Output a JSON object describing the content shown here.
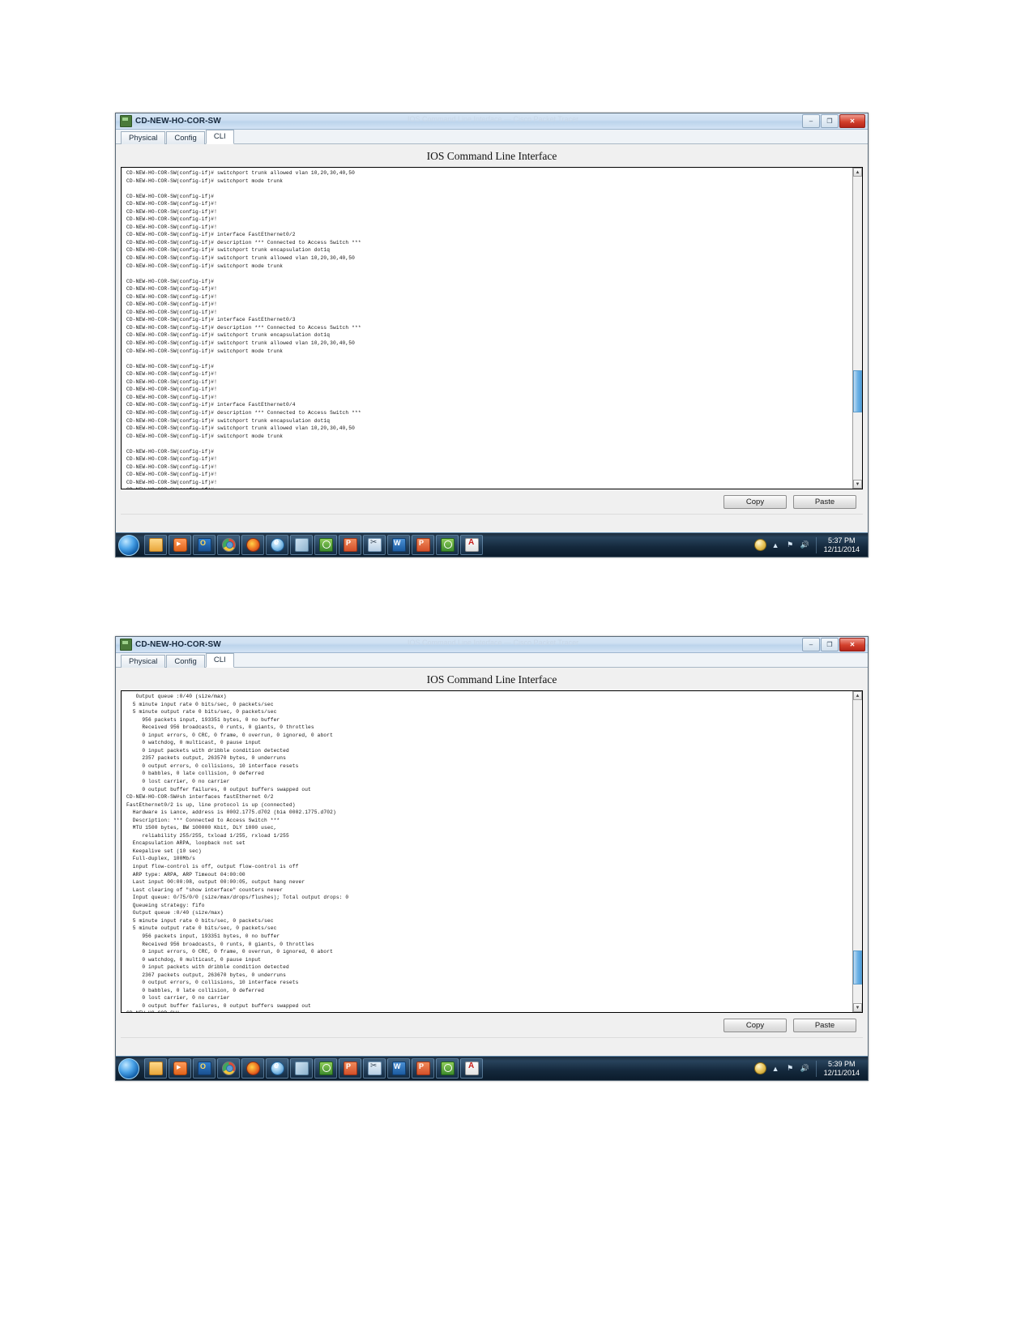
{
  "windows": [
    {
      "title": "CD-NEW-HO-COR-SW",
      "title_ghost": "IOS Command Line Interface — Cisco Packet Tracer",
      "icon": "packet-tracer-device-icon",
      "window_buttons": {
        "minimize": "–",
        "maximize": "❐",
        "close": "✕"
      },
      "tabs": [
        {
          "label": "Physical",
          "active": false
        },
        {
          "label": "Config",
          "active": false
        },
        {
          "label": "CLI",
          "active": true
        }
      ],
      "heading": "IOS Command Line Interface",
      "terminal_text": "CD-NEW-HO-COR-SW(config-if)# switchport trunk allowed vlan 10,20,30,40,50\nCD-NEW-HO-COR-SW(config-if)# switchport mode trunk\n\nCD-NEW-HO-COR-SW(config-if)#\nCD-NEW-HO-COR-SW(config-if)#!\nCD-NEW-HO-COR-SW(config-if)#!\nCD-NEW-HO-COR-SW(config-if)#!\nCD-NEW-HO-COR-SW(config-if)#!\nCD-NEW-HO-COR-SW(config-if)# interface FastEthernet0/2\nCD-NEW-HO-COR-SW(config-if)# description *** Connected to Access Switch ***\nCD-NEW-HO-COR-SW(config-if)# switchport trunk encapsulation dot1q\nCD-NEW-HO-COR-SW(config-if)# switchport trunk allowed vlan 10,20,30,40,50\nCD-NEW-HO-COR-SW(config-if)# switchport mode trunk\n\nCD-NEW-HO-COR-SW(config-if)#\nCD-NEW-HO-COR-SW(config-if)#!\nCD-NEW-HO-COR-SW(config-if)#!\nCD-NEW-HO-COR-SW(config-if)#!\nCD-NEW-HO-COR-SW(config-if)#!\nCD-NEW-HO-COR-SW(config-if)# interface FastEthernet0/3\nCD-NEW-HO-COR-SW(config-if)# description *** Connected to Access Switch ***\nCD-NEW-HO-COR-SW(config-if)# switchport trunk encapsulation dot1q\nCD-NEW-HO-COR-SW(config-if)# switchport trunk allowed vlan 10,20,30,40,50\nCD-NEW-HO-COR-SW(config-if)# switchport mode trunk\n\nCD-NEW-HO-COR-SW(config-if)#\nCD-NEW-HO-COR-SW(config-if)#!\nCD-NEW-HO-COR-SW(config-if)#!\nCD-NEW-HO-COR-SW(config-if)#!\nCD-NEW-HO-COR-SW(config-if)#!\nCD-NEW-HO-COR-SW(config-if)# interface FastEthernet0/4\nCD-NEW-HO-COR-SW(config-if)# description *** Connected to Access Switch ***\nCD-NEW-HO-COR-SW(config-if)# switchport trunk encapsulation dot1q\nCD-NEW-HO-COR-SW(config-if)# switchport trunk allowed vlan 10,20,30,40,50\nCD-NEW-HO-COR-SW(config-if)# switchport mode trunk\n\nCD-NEW-HO-COR-SW(config-if)#\nCD-NEW-HO-COR-SW(config-if)#!\nCD-NEW-HO-COR-SW(config-if)#!\nCD-NEW-HO-COR-SW(config-if)#!\nCD-NEW-HO-COR-SW(config-if)#!\nCD-NEW-HO-COR-SW(config-if)#",
      "buttons": {
        "copy": "Copy",
        "paste": "Paste"
      },
      "scrollbar": {
        "up_arrow": "▲",
        "down_arrow": "▼"
      },
      "taskbar": {
        "clock_time": "5:37 PM",
        "clock_date": "12/11/2014",
        "start_label": "start-orb",
        "items": [
          "windows-explorer-icon",
          "media-player-icon",
          "outlook-icon",
          "chrome-icon",
          "firefox-icon",
          "internet-explorer-icon",
          "notepad-icon",
          "packet-tracer-icon",
          "app-red-icon",
          "snipping-tool-icon",
          "word-icon",
          "app-orange-icon",
          "app-green-icon",
          "adobe-reader-icon"
        ],
        "tray": [
          "action-center-icon",
          "show-hidden-icon",
          "network-icon",
          "volume-icon"
        ]
      }
    },
    {
      "title": "CD-NEW-HO-COR-SW",
      "title_ghost": "IOS Command Line Interface — Cisco Packet Tracer",
      "icon": "packet-tracer-device-icon",
      "window_buttons": {
        "minimize": "–",
        "maximize": "❐",
        "close": "✕"
      },
      "tabs": [
        {
          "label": "Physical",
          "active": false
        },
        {
          "label": "Config",
          "active": false
        },
        {
          "label": "CLI",
          "active": true
        }
      ],
      "heading": "IOS Command Line Interface",
      "terminal_text": "   Output queue :0/40 (size/max)\n  5 minute input rate 0 bits/sec, 0 packets/sec\n  5 minute output rate 0 bits/sec, 0 packets/sec\n     956 packets input, 193351 bytes, 0 no buffer\n     Received 956 broadcasts, 0 runts, 0 giants, 0 throttles\n     0 input errors, 0 CRC, 0 frame, 0 overrun, 0 ignored, 0 abort\n     0 watchdog, 0 multicast, 0 pause input\n     0 input packets with dribble condition detected\n     2357 packets output, 263570 bytes, 0 underruns\n     0 output errors, 0 collisions, 10 interface resets\n     0 babbles, 0 late collision, 0 deferred\n     0 lost carrier, 0 no carrier\n     0 output buffer failures, 0 output buffers swapped out\nCD-NEW-HO-COR-SW#sh interfaces fastEthernet 0/2\nFastEthernet0/2 is up, line protocol is up (connected)\n  Hardware is Lance, address is 0002.1775.d702 (bia 0002.1775.d702)\n  Description: *** Connected to Access Switch ***\n  MTU 1500 bytes, BW 100000 Kbit, DLY 1000 usec,\n     reliability 255/255, txload 1/255, rxload 1/255\n  Encapsulation ARPA, loopback not set\n  Keepalive set (10 sec)\n  Full-duplex, 100Mb/s\n  input flow-control is off, output flow-control is off\n  ARP type: ARPA, ARP Timeout 04:00:00\n  Last input 00:00:08, output 00:00:05, output hang never\n  Last clearing of \"show interface\" counters never\n  Input queue: 0/75/0/0 (size/max/drops/flushes); Total output drops: 0\n  Queueing strategy: fifo\n  Output queue :0/40 (size/max)\n  5 minute input rate 0 bits/sec, 0 packets/sec\n  5 minute output rate 0 bits/sec, 0 packets/sec\n     956 packets input, 193351 bytes, 0 no buffer\n     Received 956 broadcasts, 0 runts, 0 giants, 0 throttles\n     0 input errors, 0 CRC, 0 frame, 0 overrun, 0 ignored, 0 abort\n     0 watchdog, 0 multicast, 0 pause input\n     0 input packets with dribble condition detected\n     2367 packets output, 263670 bytes, 0 underruns\n     0 output errors, 0 collisions, 10 interface resets\n     0 babbles, 0 late collision, 0 deferred\n     0 lost carrier, 0 no carrier\n     0 output buffer failures, 0 output buffers swapped out\nCD-NEW-HO-COR-SW#",
      "buttons": {
        "copy": "Copy",
        "paste": "Paste"
      },
      "scrollbar": {
        "up_arrow": "▲",
        "down_arrow": "▼"
      },
      "taskbar": {
        "clock_time": "5:39 PM",
        "clock_date": "12/11/2014",
        "start_label": "start-orb",
        "items": [
          "windows-explorer-icon",
          "media-player-icon",
          "outlook-icon",
          "chrome-icon",
          "firefox-icon",
          "internet-explorer-icon",
          "notepad-icon",
          "packet-tracer-icon",
          "app-red-icon",
          "snipping-tool-icon",
          "word-icon",
          "app-orange-icon",
          "app-green-icon",
          "adobe-reader-icon"
        ],
        "tray": [
          "action-center-icon",
          "show-hidden-icon",
          "network-icon",
          "volume-icon"
        ]
      }
    }
  ],
  "colors": {
    "accent": "#4c9ddb",
    "close_red": "#d3402c",
    "taskbar": "#14283c",
    "terminal_bg": "#ffffff",
    "terminal_fg": "#111111"
  }
}
